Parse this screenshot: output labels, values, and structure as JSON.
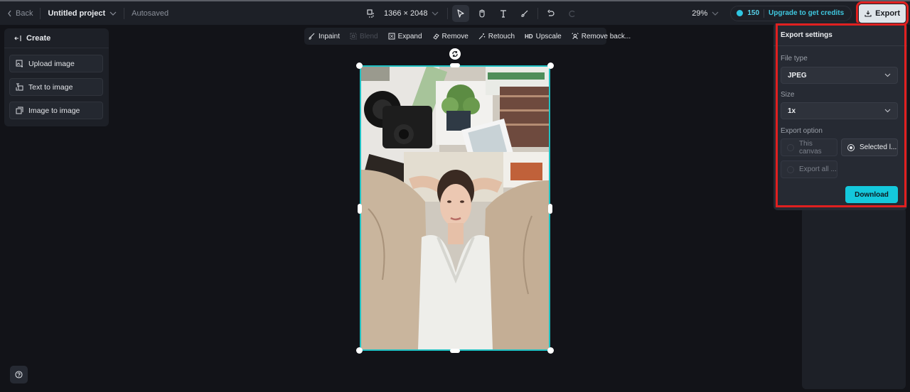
{
  "topbar": {
    "back_label": "Back",
    "project_title": "Untitled project",
    "save_status": "Autosaved",
    "canvas_size": "1366 × 2048",
    "zoom_level": "29%",
    "credits_count": "150",
    "upgrade_label": "Upgrade to get credits",
    "export_label": "Export"
  },
  "create_panel": {
    "title": "Create",
    "items": [
      {
        "label": "Upload image",
        "icon": "upload-image-icon"
      },
      {
        "label": "Text to image",
        "icon": "text-to-image-icon"
      },
      {
        "label": "Image to image",
        "icon": "image-to-image-icon"
      }
    ]
  },
  "image_tools": [
    {
      "label": "Inpaint",
      "icon": "inpaint-icon",
      "disabled": false
    },
    {
      "label": "Blend",
      "icon": "blend-icon",
      "disabled": true
    },
    {
      "label": "Expand",
      "icon": "expand-icon",
      "disabled": false
    },
    {
      "label": "Remove",
      "icon": "eraser-icon",
      "disabled": false
    },
    {
      "label": "Retouch",
      "icon": "magic-wand-icon",
      "disabled": false
    },
    {
      "label": "Upscale",
      "icon": "hd-icon",
      "disabled": false
    },
    {
      "label": "Remove back...",
      "icon": "remove-background-icon",
      "disabled": false
    }
  ],
  "export_settings": {
    "title": "Export settings",
    "file_type_label": "File type",
    "file_type_value": "JPEG",
    "size_label": "Size",
    "size_value": "1x",
    "export_option_label": "Export option",
    "options": [
      {
        "label": "This canvas",
        "selected": false
      },
      {
        "label": "Selected l...",
        "selected": true
      },
      {
        "label": "Export all ...",
        "selected": false
      }
    ],
    "download_label": "Download"
  },
  "colors": {
    "accent": "#14c8dc",
    "selection": "#1fc1c3",
    "highlight": "#e02020"
  }
}
